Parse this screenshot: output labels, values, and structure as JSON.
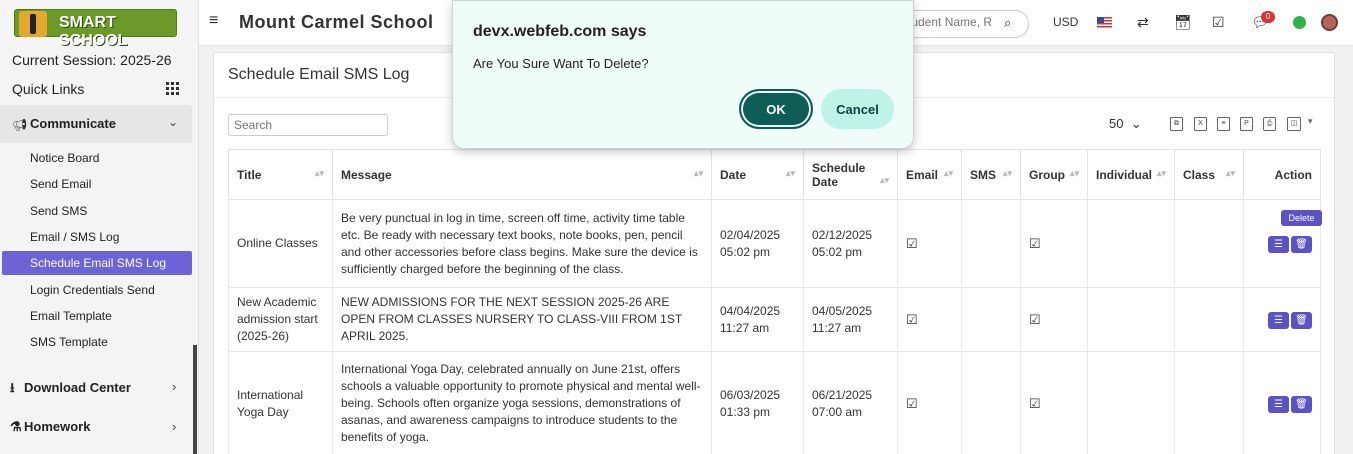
{
  "logo": {
    "text": "SMART SCHOOL"
  },
  "sidebar": {
    "session": "Current Session: 2025-26",
    "quick_links": "Quick Links",
    "section": "Communicate",
    "items": [
      "Notice Board",
      "Send Email",
      "Send SMS",
      "Email / SMS Log",
      "Schedule Email SMS Log",
      "Login Credentials Send",
      "Email Template",
      "SMS Template"
    ],
    "download_center": "Download Center",
    "homework": "Homework"
  },
  "topbar": {
    "school_name": "Mount Carmel School",
    "search_placeholder": "Student Name, R",
    "currency": "USD",
    "notification_count": "0"
  },
  "main": {
    "title": "Schedule Email SMS Log",
    "search_placeholder": "Search",
    "per_page": "50"
  },
  "table": {
    "headers": [
      "Title",
      "Message",
      "Date",
      "Schedule Date",
      "Email",
      "SMS",
      "Group",
      "Individual",
      "Class",
      "Action"
    ],
    "rows": [
      {
        "title": "Online Classes",
        "message": "Be very punctual in log in time, screen off time, activity time table etc. Be ready with necessary text books, note books, pen, pencil and other accessories before class begins. Make sure the device is sufficiently charged before the beginning of the class.",
        "date": "02/04/2025 05:02 pm",
        "schedule_date": "02/12/2025 05:02 pm"
      },
      {
        "title": "New Academic admission start (2025-26)",
        "message": "NEW ADMISSIONS FOR THE NEXT SESSION 2025-26 ARE OPEN FROM CLASSES NURSERY TO CLASS-VIII FROM 1ST APRIL 2025.",
        "date": "04/04/2025 11:27 am",
        "schedule_date": "04/05/2025 11:27 am"
      },
      {
        "title": "International Yoga Day",
        "message": "International Yoga Day, celebrated annually on June 21st, offers schools a valuable opportunity to promote physical and mental well-being. Schools often organize yoga sessions, demonstrations of asanas, and awareness campaigns to introduce students to the benefits of yoga.",
        "date": "06/03/2025 01:33 pm",
        "schedule_date": "06/21/2025 07:00 am"
      }
    ],
    "tooltip": "Delete"
  },
  "dialog": {
    "title": "devx.webfeb.com says",
    "message": "Are You Sure Want To Delete?",
    "ok_label": "OK",
    "cancel_label": "Cancel"
  }
}
